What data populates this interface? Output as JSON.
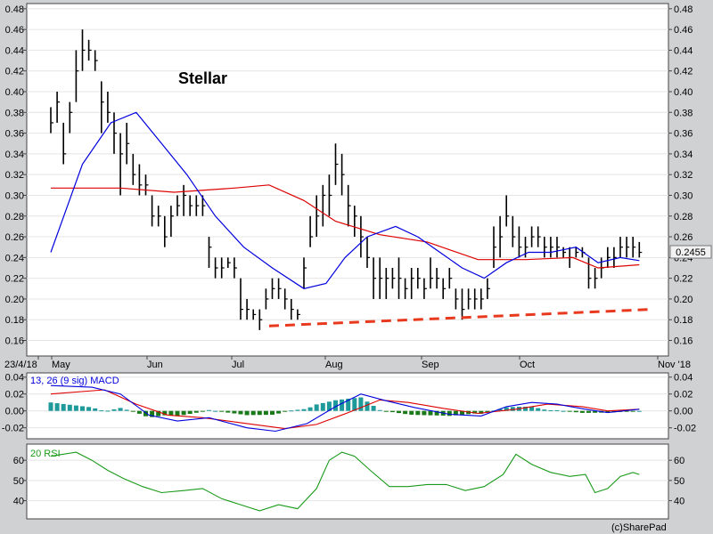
{
  "chart_data": [
    {
      "type": "ohlc",
      "title": "Stellar",
      "date_labels": [
        "23/4/18",
        "May",
        "Jun",
        "Jul",
        "Aug",
        "Sep",
        "Oct",
        "Nov '18"
      ],
      "y_ticks": [
        "0.48",
        "0.46",
        "0.44",
        "0.42",
        "0.40",
        "0.38",
        "0.36",
        "0.34",
        "0.32",
        "0.30",
        "0.28",
        "0.26",
        "0.24",
        "0.22",
        "0.20",
        "0.18",
        "0.16"
      ],
      "ylim": [
        0.145,
        0.485
      ],
      "last_price": "0.2455",
      "series_colors": {
        "price": "#000000",
        "ma_short": "#0000dd",
        "ma_long": "#dd0000",
        "trendline": "#e8391f"
      },
      "trendline": {
        "start": "2018-07-01",
        "start_value": 0.174,
        "end": "2018-10-30",
        "end_value": 0.19,
        "style": "dashed"
      },
      "price_bars": [
        [
          "2018-04-23",
          0.36,
          0.385,
          0.37
        ],
        [
          "2018-04-25",
          0.37,
          0.4,
          0.39
        ],
        [
          "2018-04-27",
          0.33,
          0.37,
          0.34
        ],
        [
          "2018-04-29",
          0.36,
          0.39,
          0.38
        ],
        [
          "2018-05-01",
          0.39,
          0.44,
          0.42
        ],
        [
          "2018-05-03",
          0.42,
          0.46,
          0.44
        ],
        [
          "2018-05-05",
          0.43,
          0.45,
          0.44
        ],
        [
          "2018-05-07",
          0.42,
          0.44,
          0.43
        ],
        [
          "2018-05-09",
          0.36,
          0.41,
          0.39
        ],
        [
          "2018-05-11",
          0.37,
          0.4,
          0.38
        ],
        [
          "2018-05-13",
          0.34,
          0.38,
          0.36
        ],
        [
          "2018-05-15",
          0.3,
          0.36,
          0.34
        ],
        [
          "2018-05-17",
          0.33,
          0.37,
          0.35
        ],
        [
          "2018-05-19",
          0.31,
          0.34,
          0.32
        ],
        [
          "2018-05-21",
          0.3,
          0.33,
          0.31
        ],
        [
          "2018-05-23",
          0.3,
          0.32,
          0.31
        ],
        [
          "2018-05-25",
          0.27,
          0.3,
          0.28
        ],
        [
          "2018-05-27",
          0.27,
          0.29,
          0.28
        ],
        [
          "2018-05-29",
          0.25,
          0.28,
          0.26
        ],
        [
          "2018-05-31",
          0.26,
          0.29,
          0.28
        ],
        [
          "2018-06-02",
          0.28,
          0.3,
          0.29
        ],
        [
          "2018-06-04",
          0.28,
          0.31,
          0.3
        ],
        [
          "2018-06-06",
          0.28,
          0.3,
          0.29
        ],
        [
          "2018-06-08",
          0.28,
          0.3,
          0.29
        ],
        [
          "2018-06-10",
          0.28,
          0.3,
          0.29
        ],
        [
          "2018-06-12",
          0.23,
          0.26,
          0.25
        ],
        [
          "2018-06-14",
          0.22,
          0.24,
          0.23
        ],
        [
          "2018-06-16",
          0.22,
          0.24,
          0.23
        ],
        [
          "2018-06-18",
          0.23,
          0.24,
          0.235
        ],
        [
          "2018-06-20",
          0.22,
          0.24,
          0.23
        ],
        [
          "2018-06-22",
          0.18,
          0.22,
          0.19
        ],
        [
          "2018-06-24",
          0.18,
          0.2,
          0.19
        ],
        [
          "2018-06-26",
          0.18,
          0.19,
          0.185
        ],
        [
          "2018-06-28",
          0.17,
          0.19,
          0.18
        ],
        [
          "2018-06-30",
          0.19,
          0.21,
          0.2
        ],
        [
          "2018-07-02",
          0.2,
          0.22,
          0.21
        ],
        [
          "2018-07-04",
          0.2,
          0.22,
          0.21
        ],
        [
          "2018-07-06",
          0.19,
          0.21,
          0.2
        ],
        [
          "2018-07-08",
          0.18,
          0.2,
          0.19
        ],
        [
          "2018-07-10",
          0.18,
          0.19,
          0.185
        ],
        [
          "2018-07-12",
          0.21,
          0.24,
          0.23
        ],
        [
          "2018-07-14",
          0.25,
          0.28,
          0.26
        ],
        [
          "2018-07-16",
          0.26,
          0.3,
          0.28
        ],
        [
          "2018-07-18",
          0.27,
          0.31,
          0.3
        ],
        [
          "2018-07-20",
          0.28,
          0.32,
          0.3
        ],
        [
          "2018-07-22",
          0.31,
          0.35,
          0.33
        ],
        [
          "2018-07-24",
          0.3,
          0.34,
          0.32
        ],
        [
          "2018-07-26",
          0.27,
          0.31,
          0.29
        ],
        [
          "2018-07-28",
          0.26,
          0.29,
          0.28
        ],
        [
          "2018-07-30",
          0.24,
          0.28,
          0.26
        ],
        [
          "2018-08-01",
          0.23,
          0.26,
          0.24
        ],
        [
          "2018-08-03",
          0.2,
          0.24,
          0.22
        ],
        [
          "2018-08-05",
          0.2,
          0.24,
          0.22
        ],
        [
          "2018-08-07",
          0.2,
          0.23,
          0.22
        ],
        [
          "2018-08-09",
          0.21,
          0.23,
          0.22
        ],
        [
          "2018-08-11",
          0.2,
          0.24,
          0.22
        ],
        [
          "2018-08-13",
          0.2,
          0.22,
          0.21
        ],
        [
          "2018-08-15",
          0.2,
          0.23,
          0.22
        ],
        [
          "2018-08-17",
          0.21,
          0.23,
          0.22
        ],
        [
          "2018-08-19",
          0.2,
          0.22,
          0.21
        ],
        [
          "2018-08-21",
          0.21,
          0.24,
          0.22
        ],
        [
          "2018-08-23",
          0.21,
          0.23,
          0.22
        ],
        [
          "2018-08-25",
          0.2,
          0.22,
          0.21
        ],
        [
          "2018-08-27",
          0.21,
          0.23,
          0.22
        ],
        [
          "2018-08-29",
          0.19,
          0.21,
          0.2
        ],
        [
          "2018-08-31",
          0.18,
          0.21,
          0.19
        ],
        [
          "2018-09-02",
          0.19,
          0.21,
          0.2
        ],
        [
          "2018-09-04",
          0.19,
          0.21,
          0.2
        ],
        [
          "2018-09-06",
          0.19,
          0.21,
          0.2
        ],
        [
          "2018-09-08",
          0.2,
          0.22,
          0.21
        ],
        [
          "2018-09-10",
          0.23,
          0.27,
          0.25
        ],
        [
          "2018-09-12",
          0.24,
          0.28,
          0.26
        ],
        [
          "2018-09-14",
          0.27,
          0.3,
          0.28
        ],
        [
          "2018-09-16",
          0.25,
          0.28,
          0.26
        ],
        [
          "2018-09-18",
          0.24,
          0.27,
          0.25
        ],
        [
          "2018-09-20",
          0.24,
          0.26,
          0.25
        ],
        [
          "2018-09-22",
          0.25,
          0.27,
          0.26
        ],
        [
          "2018-09-24",
          0.25,
          0.27,
          0.26
        ],
        [
          "2018-09-26",
          0.24,
          0.26,
          0.25
        ],
        [
          "2018-09-28",
          0.24,
          0.26,
          0.25
        ],
        [
          "2018-09-30",
          0.24,
          0.26,
          0.25
        ],
        [
          "2018-10-02",
          0.24,
          0.25,
          0.245
        ],
        [
          "2018-10-04",
          0.23,
          0.25,
          0.24
        ],
        [
          "2018-10-06",
          0.24,
          0.25,
          0.245
        ],
        [
          "2018-10-08",
          0.24,
          0.25,
          0.245
        ],
        [
          "2018-10-10",
          0.21,
          0.24,
          0.22
        ],
        [
          "2018-10-12",
          0.21,
          0.23,
          0.22
        ],
        [
          "2018-10-14",
          0.22,
          0.24,
          0.23
        ],
        [
          "2018-10-16",
          0.23,
          0.25,
          0.24
        ],
        [
          "2018-10-18",
          0.23,
          0.25,
          0.24
        ],
        [
          "2018-10-20",
          0.24,
          0.26,
          0.25
        ],
        [
          "2018-10-22",
          0.24,
          0.26,
          0.25
        ],
        [
          "2018-10-24",
          0.24,
          0.26,
          0.25
        ],
        [
          "2018-10-26",
          0.24,
          0.255,
          0.245
        ]
      ],
      "ma_short": [
        [
          "2018-04-23",
          0.245
        ],
        [
          "2018-05-03",
          0.33
        ],
        [
          "2018-05-12",
          0.37
        ],
        [
          "2018-05-20",
          0.38
        ],
        [
          "2018-05-28",
          0.35
        ],
        [
          "2018-06-05",
          0.32
        ],
        [
          "2018-06-14",
          0.28
        ],
        [
          "2018-06-23",
          0.25
        ],
        [
          "2018-07-02",
          0.23
        ],
        [
          "2018-07-12",
          0.21
        ],
        [
          "2018-07-19",
          0.215
        ],
        [
          "2018-07-25",
          0.24
        ],
        [
          "2018-08-01",
          0.26
        ],
        [
          "2018-08-10",
          0.27
        ],
        [
          "2018-08-17",
          0.26
        ],
        [
          "2018-08-24",
          0.245
        ],
        [
          "2018-08-31",
          0.23
        ],
        [
          "2018-09-07",
          0.22
        ],
        [
          "2018-09-14",
          0.235
        ],
        [
          "2018-09-21",
          0.245
        ],
        [
          "2018-09-28",
          0.245
        ],
        [
          "2018-10-06",
          0.25
        ],
        [
          "2018-10-13",
          0.235
        ],
        [
          "2018-10-20",
          0.24
        ],
        [
          "2018-10-26",
          0.237
        ]
      ],
      "ma_long": [
        [
          "2018-04-23",
          0.307
        ],
        [
          "2018-05-15",
          0.307
        ],
        [
          "2018-06-01",
          0.303
        ],
        [
          "2018-06-20",
          0.307
        ],
        [
          "2018-07-01",
          0.31
        ],
        [
          "2018-07-12",
          0.295
        ],
        [
          "2018-07-22",
          0.275
        ],
        [
          "2018-08-05",
          0.262
        ],
        [
          "2018-08-20",
          0.255
        ],
        [
          "2018-09-05",
          0.238
        ],
        [
          "2018-09-20",
          0.238
        ],
        [
          "2018-10-05",
          0.24
        ],
        [
          "2018-10-13",
          0.23
        ],
        [
          "2018-10-26",
          0.233
        ]
      ]
    },
    {
      "type": "macd",
      "title": "13, 26 (9 sig) MACD",
      "y_ticks": [
        "0.04",
        "0.02",
        "0.00",
        "-0.02"
      ],
      "ylim": [
        -0.033,
        0.045
      ],
      "series_colors": {
        "macd": "#0000dd",
        "signal": "#dd0000",
        "hist_pos": "#1e9a9a",
        "hist_neg": "#1a7a1a"
      },
      "macd": [
        [
          "2018-04-23",
          0.03
        ],
        [
          "2018-05-06",
          0.028
        ],
        [
          "2018-05-15",
          0.02
        ],
        [
          "2018-05-24",
          -0.005
        ],
        [
          "2018-06-02",
          -0.012
        ],
        [
          "2018-06-12",
          -0.008
        ],
        [
          "2018-06-24",
          -0.02
        ],
        [
          "2018-07-03",
          -0.024
        ],
        [
          "2018-07-13",
          -0.015
        ],
        [
          "2018-07-22",
          0.005
        ],
        [
          "2018-07-30",
          0.02
        ],
        [
          "2018-08-07",
          0.012
        ],
        [
          "2018-08-16",
          0.004
        ],
        [
          "2018-08-27",
          -0.004
        ],
        [
          "2018-09-06",
          -0.006
        ],
        [
          "2018-09-14",
          0.005
        ],
        [
          "2018-09-22",
          0.01
        ],
        [
          "2018-09-30",
          0.008
        ],
        [
          "2018-10-09",
          0.002
        ],
        [
          "2018-10-16",
          -0.002
        ],
        [
          "2018-10-26",
          0.002
        ]
      ],
      "signal": [
        [
          "2018-04-23",
          0.02
        ],
        [
          "2018-05-10",
          0.025
        ],
        [
          "2018-05-20",
          0.008
        ],
        [
          "2018-05-30",
          -0.005
        ],
        [
          "2018-06-10",
          -0.008
        ],
        [
          "2018-06-24",
          -0.015
        ],
        [
          "2018-07-06",
          -0.021
        ],
        [
          "2018-07-16",
          -0.016
        ],
        [
          "2018-07-26",
          -0.002
        ],
        [
          "2018-08-05",
          0.013
        ],
        [
          "2018-08-14",
          0.01
        ],
        [
          "2018-08-25",
          0.003
        ],
        [
          "2018-09-05",
          -0.003
        ],
        [
          "2018-09-17",
          0.002
        ],
        [
          "2018-09-27",
          0.008
        ],
        [
          "2018-10-08",
          0.005
        ],
        [
          "2018-10-16",
          0.0
        ],
        [
          "2018-10-26",
          0.002
        ]
      ]
    },
    {
      "type": "rsi",
      "title": "20 RSI",
      "y_ticks": [
        "60",
        "50",
        "40"
      ],
      "ylim": [
        31,
        68
      ],
      "series_colors": {
        "rsi": "#1a9a1a"
      },
      "rsi": [
        [
          "2018-04-23",
          62
        ],
        [
          "2018-05-01",
          64
        ],
        [
          "2018-05-06",
          60
        ],
        [
          "2018-05-11",
          55
        ],
        [
          "2018-05-16",
          51
        ],
        [
          "2018-05-22",
          47
        ],
        [
          "2018-05-28",
          44
        ],
        [
          "2018-06-04",
          45
        ],
        [
          "2018-06-10",
          46
        ],
        [
          "2018-06-16",
          41
        ],
        [
          "2018-06-22",
          38
        ],
        [
          "2018-06-28",
          35
        ],
        [
          "2018-07-04",
          38
        ],
        [
          "2018-07-10",
          36
        ],
        [
          "2018-07-16",
          46
        ],
        [
          "2018-07-20",
          60
        ],
        [
          "2018-07-24",
          64
        ],
        [
          "2018-07-28",
          62
        ],
        [
          "2018-08-02",
          55
        ],
        [
          "2018-08-08",
          47
        ],
        [
          "2018-08-14",
          47
        ],
        [
          "2018-08-20",
          48
        ],
        [
          "2018-08-26",
          48
        ],
        [
          "2018-09-01",
          45
        ],
        [
          "2018-09-07",
          47
        ],
        [
          "2018-09-13",
          53
        ],
        [
          "2018-09-17",
          63
        ],
        [
          "2018-09-22",
          58
        ],
        [
          "2018-09-28",
          54
        ],
        [
          "2018-10-04",
          52
        ],
        [
          "2018-10-09",
          53
        ],
        [
          "2018-10-12",
          44
        ],
        [
          "2018-10-16",
          46
        ],
        [
          "2018-10-20",
          52
        ],
        [
          "2018-10-24",
          54
        ],
        [
          "2018-10-26",
          53
        ]
      ]
    }
  ],
  "footer": {
    "credit": "(c)SharePad"
  }
}
